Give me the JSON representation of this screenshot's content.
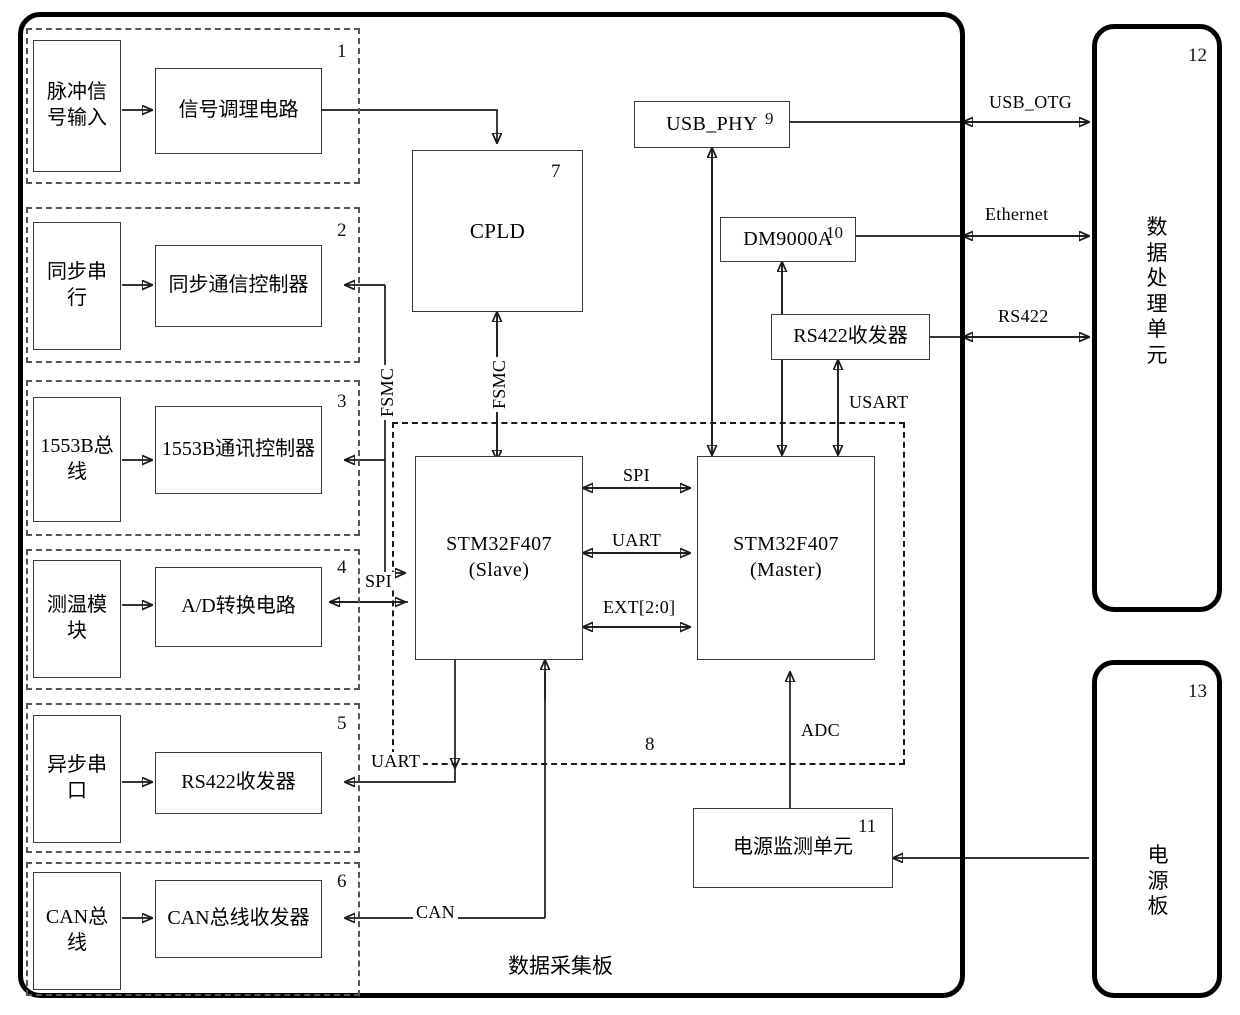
{
  "diagram": {
    "caption": "数据采集板",
    "board_label": "数据采集板"
  },
  "groups": [
    {
      "id": "1",
      "index": "1",
      "source": "脉冲信号输入",
      "block": "信号调理电路"
    },
    {
      "id": "2",
      "index": "2",
      "source": "同步串行",
      "block": "同步通信控制器"
    },
    {
      "id": "3",
      "index": "3",
      "source": "1553B总线",
      "block": "1553B通讯控制器"
    },
    {
      "id": "4",
      "index": "4",
      "source": "测温模块",
      "block": "A/D转换电路"
    },
    {
      "id": "5",
      "index": "5",
      "source": "异步串口",
      "block": "RS422收发器"
    },
    {
      "id": "6",
      "index": "6",
      "source": "CAN总线",
      "block": "CAN总线收发器"
    }
  ],
  "blocks": {
    "cpld": {
      "label": "CPLD",
      "index": "7"
    },
    "mcu_group_index": "8",
    "slave": {
      "line1": "STM32F407",
      "line2": "(Slave)"
    },
    "master": {
      "line1": "STM32F407",
      "line2": "(Master)"
    },
    "usb_phy": {
      "label": "USB_PHY",
      "index": "9"
    },
    "dm9000a": {
      "label": "DM9000A",
      "index": "10"
    },
    "rs422_tx": {
      "label": "RS422收发器"
    },
    "power_monitor": {
      "label": "电源监测单元",
      "index": "11"
    }
  },
  "units": {
    "data_processing": {
      "label": "数据处理单元",
      "index": "12"
    },
    "power_board": {
      "label": "电源板",
      "index": "13"
    }
  },
  "bus_labels": {
    "fsmc_left": "FSMC",
    "fsmc_cpld": "FSMC",
    "spi_left": "SPI",
    "uart_left": "UART",
    "can_left": "CAN",
    "spi_mcu": "SPI",
    "uart_mcu": "UART",
    "ext_mcu": "EXT[2:0]",
    "usart": "USART",
    "adc": "ADC",
    "usb_otg": "USB_OTG",
    "ethernet": "Ethernet",
    "rs422": "RS422"
  },
  "colors": {
    "line": "#1a1a1a",
    "block_border": "#3a3a3a",
    "group_dash": "#555555",
    "board_border": "#000000",
    "background": "#ffffff"
  }
}
